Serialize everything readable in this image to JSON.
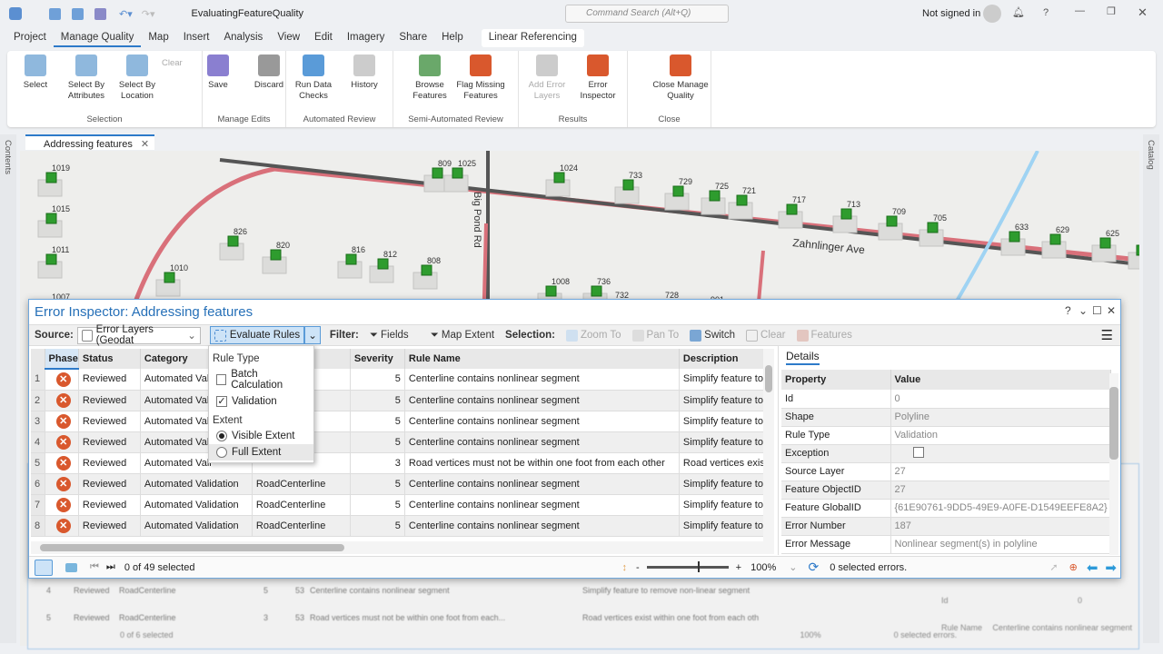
{
  "app": {
    "project_name": "EvaluatingFeatureQuality",
    "search_placeholder": "Command Search (Alt+Q)",
    "signin": "Not signed in"
  },
  "tabs": [
    "Project",
    "Manage Quality",
    "Map",
    "Insert",
    "Analysis",
    "View",
    "Edit",
    "Imagery",
    "Share",
    "Help"
  ],
  "context_tab": "Linear Referencing",
  "ribbon": {
    "groups": [
      {
        "label": "Selection",
        "buttons": [
          "Select",
          "Select By Attributes",
          "Select By Location"
        ],
        "small": "Clear"
      },
      {
        "label": "Manage Edits",
        "buttons": [
          "Save",
          "Discard"
        ]
      },
      {
        "label": "Automated Review",
        "buttons": [
          "Run Data Checks",
          "History"
        ]
      },
      {
        "label": "Semi-Automated Review",
        "buttons": [
          "Browse Features",
          "Flag Missing Features"
        ]
      },
      {
        "label": "Results",
        "buttons": [
          "Add Error Layers",
          "Error Inspector"
        ]
      },
      {
        "label": "Close",
        "buttons": [
          "Close Manage Quality"
        ]
      }
    ]
  },
  "map_tab": "Addressing features",
  "side": {
    "left": "Contents",
    "right": "Catalog"
  },
  "map": {
    "labels": [
      "1019",
      "1015",
      "1011",
      "1010",
      "1007",
      "826",
      "820",
      "816",
      "812",
      "808",
      "809",
      "1025",
      "1024",
      "733",
      "729",
      "725",
      "721",
      "717",
      "713",
      "709",
      "705",
      "633",
      "629",
      "625",
      "621",
      "1008",
      "736",
      "732",
      "728",
      "901"
    ],
    "street": "Zahnlinger Ave",
    "street2": "Big Pond Rd"
  },
  "dialog": {
    "title": "Error Inspector: Addressing features",
    "source_label": "Source:",
    "source_value": "Error Layers (Geodat",
    "evaluate": "Evaluate Rules",
    "filter_label": "Filter:",
    "fields": "Fields",
    "map_extent": "Map Extent",
    "selection_label": "Selection:",
    "zoom_to": "Zoom To",
    "pan_to": "Pan To",
    "switch": "Switch",
    "clear": "Clear",
    "features": "Features",
    "columns": [
      "Phase",
      "Status",
      "Category",
      "",
      "Severity",
      "Rule Name",
      "Description"
    ],
    "rows": [
      [
        "1",
        "Reviewed",
        "Automated Vali",
        "",
        "5",
        "Centerline contains nonlinear segment",
        "Simplify feature to"
      ],
      [
        "2",
        "Reviewed",
        "Automated Vali",
        "",
        "5",
        "Centerline contains nonlinear segment",
        "Simplify feature to"
      ],
      [
        "3",
        "Reviewed",
        "Automated Vali",
        "",
        "5",
        "Centerline contains nonlinear segment",
        "Simplify feature to"
      ],
      [
        "4",
        "Reviewed",
        "Automated Vali",
        "",
        "5",
        "Centerline contains nonlinear segment",
        "Simplify feature to"
      ],
      [
        "5",
        "Reviewed",
        "Automated Vali",
        "",
        "3",
        "Road vertices must not be within one foot from each other",
        "Road vertices exist"
      ],
      [
        "6",
        "Reviewed",
        "Automated Validation",
        "RoadCenterline",
        "5",
        "Centerline contains nonlinear segment",
        "Simplify feature to"
      ],
      [
        "7",
        "Reviewed",
        "Automated Validation",
        "RoadCenterline",
        "5",
        "Centerline contains nonlinear segment",
        "Simplify feature to"
      ],
      [
        "8",
        "Reviewed",
        "Automated Validation",
        "RoadCenterline",
        "5",
        "Centerline contains nonlinear segment",
        "Simplify feature to"
      ]
    ],
    "menu": {
      "rule_type": "Rule Type",
      "batch": "Batch Calculation",
      "batch_checked": false,
      "validation": "Validation",
      "validation_checked": true,
      "extent": "Extent",
      "visible": "Visible Extent",
      "full": "Full Extent",
      "selected_extent": "Visible Extent"
    },
    "footer": {
      "selected": "0 of 49 selected",
      "zoom": "100%",
      "errors": "0 selected errors."
    },
    "details_tab": "Details",
    "details_cols": [
      "Property",
      "Value"
    ],
    "details": [
      [
        "Id",
        "0"
      ],
      [
        "Shape",
        "Polyline"
      ],
      [
        "Rule Type",
        "Validation"
      ],
      [
        "Exception",
        ""
      ],
      [
        "Source Layer",
        "27"
      ],
      [
        "Feature ObjectID",
        "27"
      ],
      [
        "Feature GlobalID",
        "{61E90761-9DD5-49E9-A0FE-D1549EEFE8A2}"
      ],
      [
        "Error Number",
        "187"
      ],
      [
        "Error Message",
        "Nonlinear segment(s) in polyline"
      ]
    ]
  },
  "background_panel": {
    "rows": [
      [
        "4",
        "Reviewed",
        "RoadCenterline",
        "5",
        "53",
        "Centerline contains nonlinear segment",
        "Simplify feature to remove non-linear segment"
      ],
      [
        "5",
        "Reviewed",
        "RoadCenterline",
        "3",
        "53",
        "Road vertices must not be within one foot from each...",
        "Road vertices exist within one foot from each oth"
      ]
    ],
    "details": [
      [
        "Feature ObjectID",
        "27"
      ],
      [
        "Id",
        "0"
      ],
      [
        "Rule Name",
        "Centerline contains nonlinear segment"
      ]
    ],
    "selected": "0 of 6 selected",
    "zoom": "100%",
    "errors": "0 selected errors."
  },
  "colors": {
    "accent": "#2d7ac9",
    "error": "#d9582d",
    "marker": "#2e9c2e",
    "road": "#555555",
    "highlight_road": "#d9707a"
  }
}
